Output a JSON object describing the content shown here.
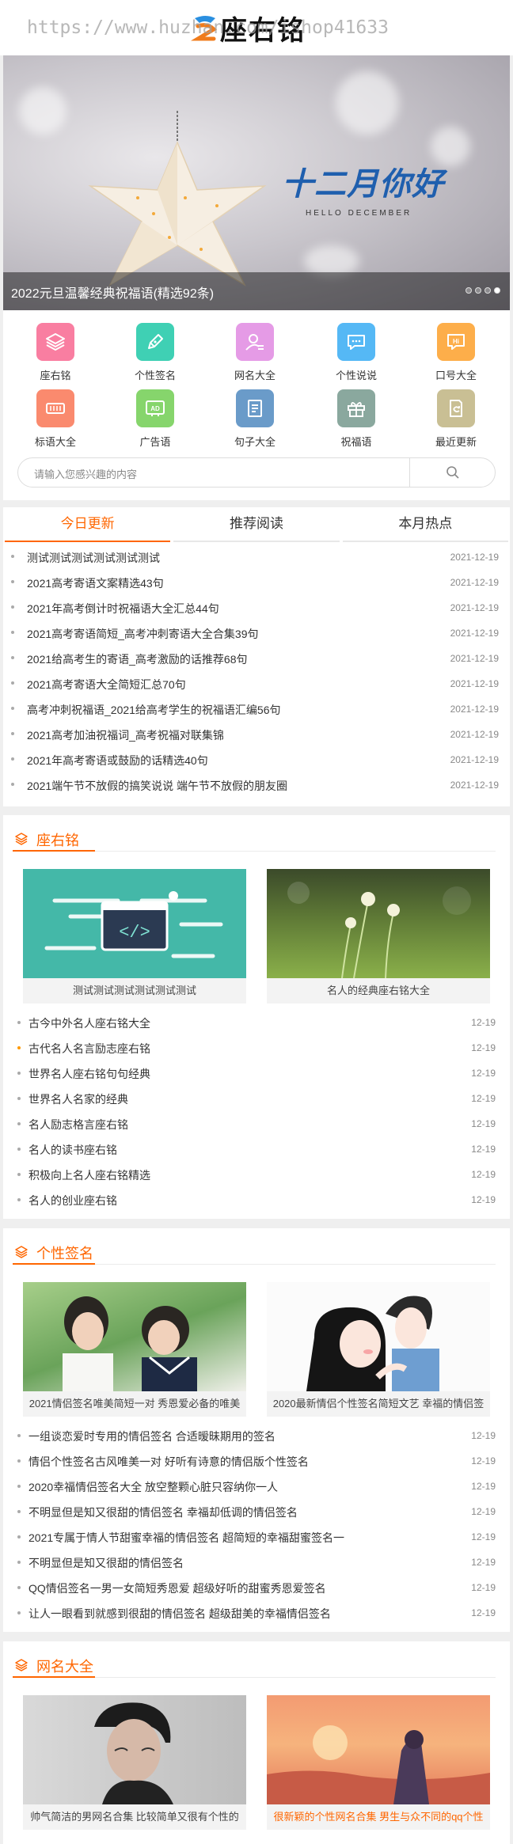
{
  "watermark": "https://www.huzhan.com/ishop41633",
  "logo": {
    "text": "座右铭"
  },
  "banner": {
    "caption": "2022元旦温馨经典祝福语(精选92条)",
    "art_title": "十二月你好",
    "art_subtitle": "HELLO DECEMBER",
    "slide_count": 4,
    "active_slide": 4
  },
  "categories": [
    {
      "label": "座右铭",
      "icon": "layers-icon",
      "color": "#f97ea1"
    },
    {
      "label": "个性签名",
      "icon": "pen-icon",
      "color": "#3fd0b4"
    },
    {
      "label": "网名大全",
      "icon": "user-list-icon",
      "color": "#e59be6"
    },
    {
      "label": "个性说说",
      "icon": "chat-icon",
      "color": "#55b8f5"
    },
    {
      "label": "口号大全",
      "icon": "hi-icon",
      "color": "#fdae4a"
    },
    {
      "label": "标语大全",
      "icon": "banner-icon",
      "color": "#fa8a6e"
    },
    {
      "label": "广告语",
      "icon": "ad-icon",
      "color": "#86d56c"
    },
    {
      "label": "句子大全",
      "icon": "book-icon",
      "color": "#6a9bc9"
    },
    {
      "label": "祝福语",
      "icon": "gift-icon",
      "color": "#8aa89e"
    },
    {
      "label": "最近更新",
      "icon": "refresh-doc-icon",
      "color": "#c9bf94"
    }
  ],
  "search": {
    "placeholder": "请输入您感兴趣的内容"
  },
  "tabs": [
    "今日更新",
    "推荐阅读",
    "本月热点"
  ],
  "today_list": [
    {
      "title": "测试测试测试测试测试测试",
      "date": "2021-12-19"
    },
    {
      "title": "2021高考寄语文案精选43句",
      "date": "2021-12-19"
    },
    {
      "title": "2021年高考倒计时祝福语大全汇总44句",
      "date": "2021-12-19"
    },
    {
      "title": "2021高考寄语简短_高考冲刺寄语大全合集39句",
      "date": "2021-12-19"
    },
    {
      "title": "2021给高考生的寄语_高考激励的话推荐68句",
      "date": "2021-12-19"
    },
    {
      "title": "2021高考寄语大全简短汇总70句",
      "date": "2021-12-19"
    },
    {
      "title": "高考冲刺祝福语_2021给高考学生的祝福语汇编56句",
      "date": "2021-12-19"
    },
    {
      "title": "2021高考加油祝福词_高考祝福对联集锦",
      "date": "2021-12-19"
    },
    {
      "title": "2021年高考寄语或鼓励的话精选40句",
      "date": "2021-12-19"
    },
    {
      "title": "2021端午节不放假的搞笑说说 端午节不放假的朋友圈",
      "date": "2021-12-19"
    }
  ],
  "sections": [
    {
      "title": "座右铭",
      "cards": [
        {
          "caption": "测试测试测试测试测试测试",
          "highlight": false
        },
        {
          "caption": "名人的经典座右铭大全",
          "highlight": false
        }
      ],
      "items": [
        {
          "title": "古今中外名人座右铭大全",
          "date": "12-19"
        },
        {
          "title": "古代名人名言励志座右铭",
          "date": "12-19"
        },
        {
          "title": "世界名人座右铭句句经典",
          "date": "12-19"
        },
        {
          "title": "世界名人名家的经典",
          "date": "12-19"
        },
        {
          "title": "名人励志格言座右铭",
          "date": "12-19"
        },
        {
          "title": "名人的读书座右铭",
          "date": "12-19"
        },
        {
          "title": "积极向上名人座右铭精选",
          "date": "12-19"
        },
        {
          "title": "名人的创业座右铭",
          "date": "12-19"
        }
      ]
    },
    {
      "title": "个性签名",
      "cards": [
        {
          "caption": "2021情侣签名唯美简短一对 秀恩爱必备的唯美",
          "highlight": false
        },
        {
          "caption": "2020最新情侣个性签名简短文艺 幸福的情侣签",
          "highlight": false
        }
      ],
      "items": [
        {
          "title": "一组谈恋爱时专用的情侣签名 合适暧昧期用的签名",
          "date": "12-19"
        },
        {
          "title": "情侣个性签名古风唯美一对 好听有诗意的情侣版个性签名",
          "date": "12-19"
        },
        {
          "title": "2020幸福情侣签名大全 放空整颗心脏只容纳你一人",
          "date": "12-19"
        },
        {
          "title": "不明显但是知又很甜的情侣签名 幸福却低调的情侣签名",
          "date": "12-19"
        },
        {
          "title": "2021专属于情人节甜蜜幸福的情侣签名 超简短的幸福甜蜜签名一",
          "date": "12-19"
        },
        {
          "title": "不明显但是知又很甜的情侣签名",
          "date": "12-19"
        },
        {
          "title": "QQ情侣签名一男一女简短秀恩爱 超级好听的甜蜜秀恩爱签名",
          "date": "12-19"
        },
        {
          "title": "让人一眼看到就感到很甜的情侣签名 超级甜美的幸福情侣签名",
          "date": "12-19"
        }
      ]
    },
    {
      "title": "网名大全",
      "cards": [
        {
          "caption": "帅气简洁的男网名合集 比较简单又很有个性的",
          "highlight": false
        },
        {
          "caption": "很新颖的个性网名合集 男生与众不同的qq个性",
          "highlight": true
        }
      ]
    }
  ],
  "colors": {
    "accent": "#ff6600"
  }
}
